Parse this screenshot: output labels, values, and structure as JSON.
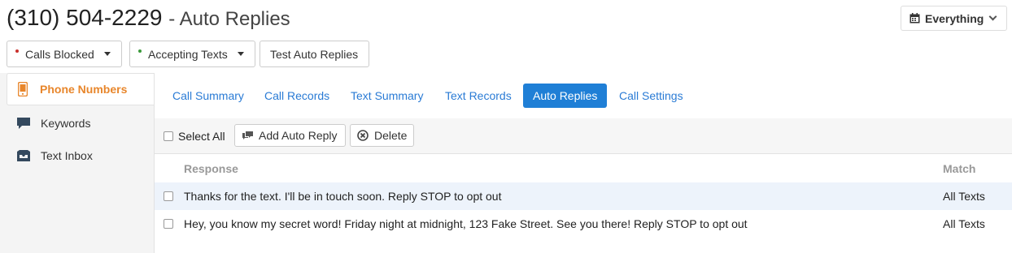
{
  "header": {
    "phone": "(310) 504-2229",
    "subtitle": "- Auto Replies",
    "status_buttons": [
      {
        "label": "Calls Blocked",
        "dot_color": "#c9302c"
      },
      {
        "label": "Accepting Texts",
        "dot_color": "#3c9a3c"
      }
    ],
    "test_button": "Test Auto Replies",
    "range_selector": "Everything"
  },
  "sidebar": {
    "items": [
      {
        "label": "Phone Numbers",
        "icon": "phone-icon",
        "active": true
      },
      {
        "label": "Keywords",
        "icon": "speech-bubble-icon",
        "active": false
      },
      {
        "label": "Text Inbox",
        "icon": "inbox-icon",
        "active": false
      }
    ]
  },
  "tabs": [
    {
      "label": "Call Summary",
      "active": false
    },
    {
      "label": "Call Records",
      "active": false
    },
    {
      "label": "Text Summary",
      "active": false
    },
    {
      "label": "Text Records",
      "active": false
    },
    {
      "label": "Auto Replies",
      "active": true
    },
    {
      "label": "Call Settings",
      "active": false
    }
  ],
  "toolbar": {
    "select_all": "Select All",
    "add_button": "Add Auto Reply",
    "delete_button": "Delete"
  },
  "table": {
    "columns": [
      "Response",
      "Match"
    ],
    "rows": [
      {
        "response": "Thanks for the text. I'll be in touch soon. Reply STOP to opt out",
        "match": "All Texts"
      },
      {
        "response": "Hey, you know my secret word! Friday night at midnight, 123 Fake Street. See you there! Reply STOP to opt out",
        "match": "All Texts"
      }
    ]
  },
  "colors": {
    "accent_orange": "#e8862b",
    "link_blue": "#2a7bd5",
    "active_tab": "#1f7fd6"
  }
}
